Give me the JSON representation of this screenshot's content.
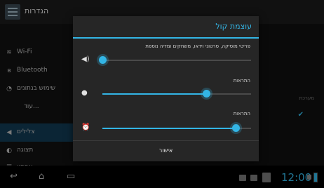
{
  "topbar": {
    "title": "הגדרות",
    "icon": "settings-icon"
  },
  "sidebar": {
    "items": [
      {
        "label": "Wi-Fi",
        "icon": "wifi-icon"
      },
      {
        "label": "Bluetooth",
        "icon": "bluetooth-icon"
      },
      {
        "label": "שימוש בנתונים",
        "icon": "data-usage-icon"
      },
      {
        "label": "עוד...",
        "icon": ""
      },
      {
        "label": "צלילים",
        "icon": "volume-icon"
      },
      {
        "label": "תצוגה",
        "icon": "brightness-icon"
      },
      {
        "label": "אחסון",
        "icon": "storage-icon"
      }
    ]
  },
  "content": {
    "system_label": "מערכת",
    "check_state": true
  },
  "dialog": {
    "title": "עוצמת קול",
    "media": {
      "label": "פריטי מוסיקה, סרטוני וידאו, משחקים ומדיה נוספת",
      "icon": "speaker-icon",
      "level": 0.0
    },
    "notifications": {
      "label": "התראות",
      "icon": "notification-icon",
      "level": 0.7
    },
    "alarm": {
      "label": "התראות",
      "icon": "alarm-icon",
      "level": 0.9
    },
    "ok_label": "אישור"
  },
  "navbar": {
    "clock": "12:00",
    "back_icon": "back-icon",
    "home_icon": "home-icon",
    "recents_icon": "recents-icon"
  },
  "colors": {
    "accent": "#33b5e5",
    "background": "#0a0a0a",
    "dialog": "#262626"
  }
}
